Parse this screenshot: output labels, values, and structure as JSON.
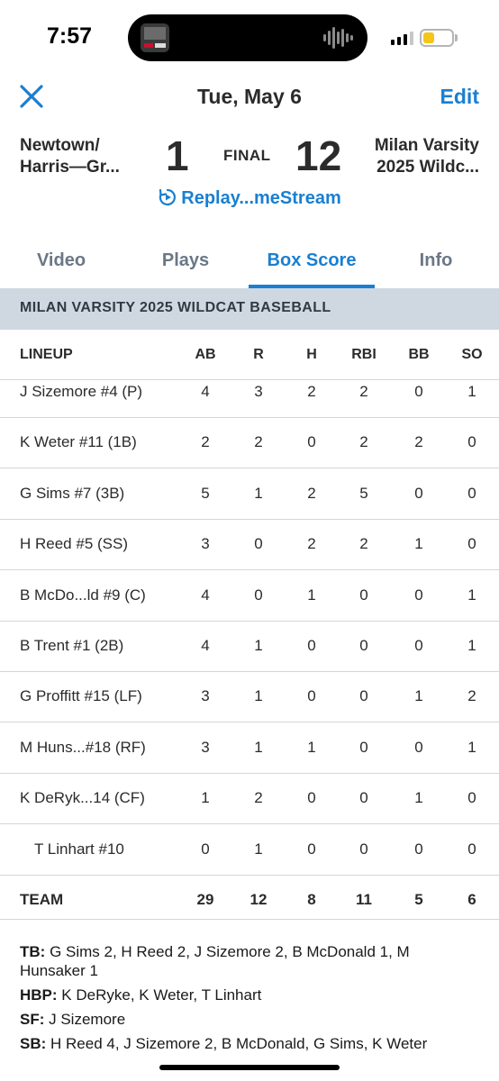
{
  "status": {
    "time": "7:57"
  },
  "header": {
    "date": "Tue, May 6",
    "edit_label": "Edit"
  },
  "scoreboard": {
    "home_team_line1": "Newtown/",
    "home_team_line2": "Harris—Gr...",
    "home_score": "1",
    "status": "FINAL",
    "away_score": "12",
    "away_team_line1": "Milan Varsity",
    "away_team_line2": "2025 Wildc...",
    "replay_label": "Replay...meStream"
  },
  "tabs": [
    {
      "label": "Video"
    },
    {
      "label": "Plays"
    },
    {
      "label": "Box Score",
      "active": true
    },
    {
      "label": "Info"
    }
  ],
  "section_title": "MILAN VARSITY 2025 WILDCAT BASEBALL",
  "box_score": {
    "columns": [
      "LINEUP",
      "AB",
      "R",
      "H",
      "RBI",
      "BB",
      "SO"
    ],
    "rows": [
      {
        "name": "J Sizemore #4 (P)",
        "ab": "4",
        "r": "3",
        "h": "2",
        "rbi": "2",
        "bb": "0",
        "so": "1"
      },
      {
        "name": "K Weter #11 (1B)",
        "ab": "2",
        "r": "2",
        "h": "0",
        "rbi": "2",
        "bb": "2",
        "so": "0"
      },
      {
        "name": "G Sims #7 (3B)",
        "ab": "5",
        "r": "1",
        "h": "2",
        "rbi": "5",
        "bb": "0",
        "so": "0"
      },
      {
        "name": "H Reed #5 (SS)",
        "ab": "3",
        "r": "0",
        "h": "2",
        "rbi": "2",
        "bb": "1",
        "so": "0"
      },
      {
        "name": "B McDo...ld #9 (C)",
        "ab": "4",
        "r": "0",
        "h": "1",
        "rbi": "0",
        "bb": "0",
        "so": "1"
      },
      {
        "name": "B Trent #1 (2B)",
        "ab": "4",
        "r": "1",
        "h": "0",
        "rbi": "0",
        "bb": "0",
        "so": "1"
      },
      {
        "name": "G Proffitt #15 (LF)",
        "ab": "3",
        "r": "1",
        "h": "0",
        "rbi": "0",
        "bb": "1",
        "so": "2"
      },
      {
        "name": "M Huns...#18 (RF)",
        "ab": "3",
        "r": "1",
        "h": "1",
        "rbi": "0",
        "bb": "0",
        "so": "1"
      },
      {
        "name": "K DeRyk...14 (CF)",
        "ab": "1",
        "r": "2",
        "h": "0",
        "rbi": "0",
        "bb": "1",
        "so": "0"
      },
      {
        "name": "T Linhart #10",
        "ab": "0",
        "r": "1",
        "h": "0",
        "rbi": "0",
        "bb": "0",
        "so": "0",
        "sub": true
      }
    ],
    "totals": {
      "name": "TEAM",
      "ab": "29",
      "r": "12",
      "h": "8",
      "rbi": "11",
      "bb": "5",
      "so": "6"
    }
  },
  "notes": [
    {
      "label": "TB:",
      "text": "G Sims 2, H Reed 2, J Sizemore 2, B McDonald 1, M Hunsaker 1"
    },
    {
      "label": "HBP:",
      "text": "K DeRyke, K Weter, T Linhart"
    },
    {
      "label": "SF:",
      "text": "J Sizemore"
    },
    {
      "label": "SB:",
      "text": "H Reed 4, J Sizemore 2, B McDonald, G Sims, K Weter"
    }
  ]
}
